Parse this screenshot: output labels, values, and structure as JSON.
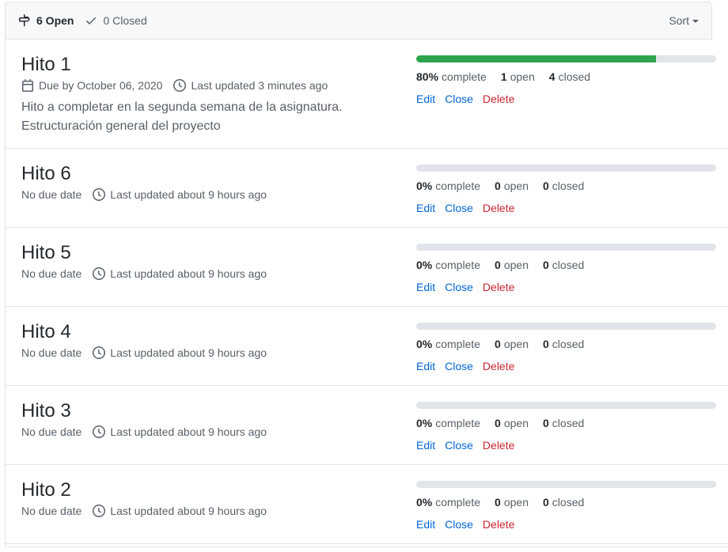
{
  "header": {
    "open_count": "6 Open",
    "closed_count": "0 Closed",
    "sort_label": "Sort"
  },
  "milestones": [
    {
      "title": "Hito 1",
      "due": "Due by October 06, 2020",
      "updated": "Last updated 3 minutes ago",
      "description": [
        "Hito a completar en la segunda semana de la asignatura.",
        "Estructuración general del proyecto"
      ],
      "progress_percent": 80,
      "percent_label": "80%",
      "open": "1",
      "closed": "4"
    },
    {
      "title": "Hito 6",
      "due": "No due date",
      "updated": "Last updated about 9 hours ago",
      "progress_percent": 0,
      "percent_label": "0%",
      "open": "0",
      "closed": "0"
    },
    {
      "title": "Hito 5",
      "due": "No due date",
      "updated": "Last updated about 9 hours ago",
      "progress_percent": 0,
      "percent_label": "0%",
      "open": "0",
      "closed": "0"
    },
    {
      "title": "Hito 4",
      "due": "No due date",
      "updated": "Last updated about 9 hours ago",
      "progress_percent": 0,
      "percent_label": "0%",
      "open": "0",
      "closed": "0"
    },
    {
      "title": "Hito 3",
      "due": "No due date",
      "updated": "Last updated about 9 hours ago",
      "progress_percent": 0,
      "percent_label": "0%",
      "open": "0",
      "closed": "0"
    },
    {
      "title": "Hito 2",
      "due": "No due date",
      "updated": "Last updated about 9 hours ago",
      "progress_percent": 0,
      "percent_label": "0%",
      "open": "0",
      "closed": "0"
    }
  ],
  "labels": {
    "complete": "complete",
    "open": "open",
    "closed": "closed",
    "edit": "Edit",
    "close": "Close",
    "delete": "Delete"
  },
  "colors": {
    "progress_fill": "#2ea44f",
    "progress_track": "#e1e4e8",
    "link": "#0366d6",
    "danger": "#cb2431"
  },
  "icons": {
    "open": "milestone-icon",
    "closed": "check-icon",
    "due": "calendar-icon",
    "updated": "clock-icon"
  }
}
